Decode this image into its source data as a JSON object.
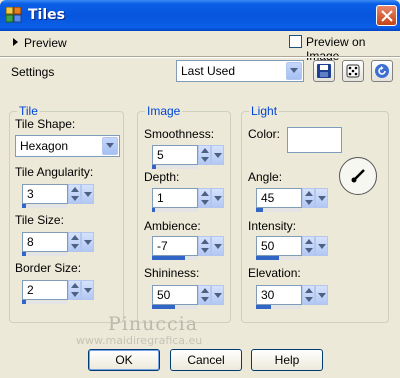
{
  "window": {
    "title": "Tiles",
    "icon": "tiles-icon",
    "close_icon": "close-icon"
  },
  "preview": {
    "toggle_label": "Preview",
    "preview_on_image_label": "Preview on Image",
    "preview_on_image_checked": false
  },
  "settings": {
    "label": "Settings",
    "preset_value": "Last Used",
    "buttons": [
      "save-preset-icon",
      "randomize-icon",
      "reset-icon"
    ]
  },
  "tile": {
    "group_title": "Tile",
    "shape_label": "Tile Shape:",
    "shape_value": "Hexagon",
    "angularity_label": "Tile Angularity:",
    "angularity_value": "3",
    "size_label": "Tile Size:",
    "size_value": "8",
    "border_label": "Border Size:",
    "border_value": "2"
  },
  "image": {
    "group_title": "Image",
    "smoothness_label": "Smoothness:",
    "smoothness_value": "5",
    "depth_label": "Depth:",
    "depth_value": "1",
    "ambience_label": "Ambience:",
    "ambience_value": "-7",
    "shininess_label": "Shininess:",
    "shininess_value": "50"
  },
  "light": {
    "group_title": "Light",
    "color_label": "Color:",
    "color_value": "#ffffff",
    "angle_label": "Angle:",
    "angle_value": "45",
    "intensity_label": "Intensity:",
    "intensity_value": "50",
    "elevation_label": "Elevation:",
    "elevation_value": "30"
  },
  "watermark": {
    "name": "Pinuccia",
    "url": "www.maidiregrafica.eu"
  },
  "footer": {
    "ok_label": "OK",
    "cancel_label": "Cancel",
    "help_label": "Help"
  },
  "colors": {
    "titlebar": "#0855dd",
    "group_title": "#0046d5",
    "slider_fill": "#3166c7",
    "dialog_bg": "#ece9d8"
  }
}
